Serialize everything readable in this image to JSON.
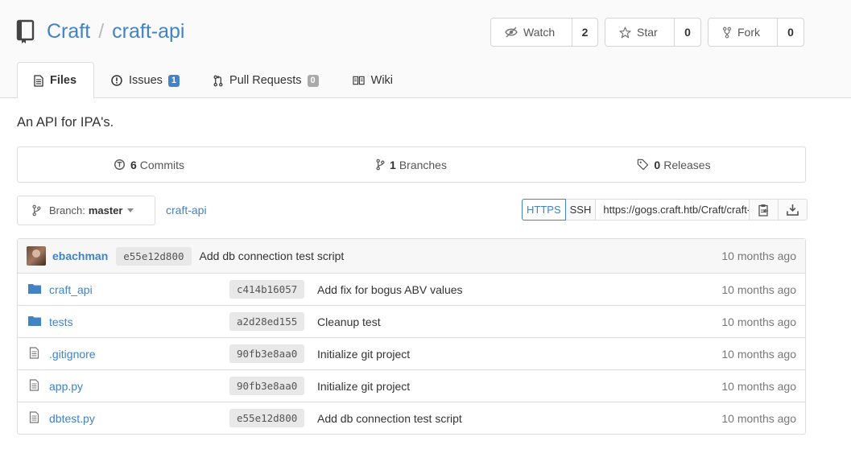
{
  "repo": {
    "owner": "Craft",
    "separator": "/",
    "name": "craft-api"
  },
  "actions": {
    "watch": {
      "label": "Watch",
      "count": "2"
    },
    "star": {
      "label": "Star",
      "count": "0"
    },
    "fork": {
      "label": "Fork",
      "count": "0"
    }
  },
  "tabs": [
    {
      "label": "Files",
      "active": true
    },
    {
      "label": "Issues",
      "badge": "1",
      "badge_color": "#4183c4"
    },
    {
      "label": "Pull Requests",
      "badge": "0",
      "badge_color": "#aaaaaa"
    },
    {
      "label": "Wiki"
    }
  ],
  "description": "An API for IPA's.",
  "stats": {
    "commits": {
      "count": "6",
      "label": "Commits"
    },
    "branches": {
      "count": "1",
      "label": "Branches"
    },
    "releases": {
      "count": "0",
      "label": "Releases"
    }
  },
  "branch": {
    "prefix": "Branch:",
    "name": "master"
  },
  "breadcrumb": "craft-api",
  "clone": {
    "https_label": "HTTPS",
    "ssh_label": "SSH",
    "url": "https://gogs.craft.htb/Craft/craft-api.git"
  },
  "latest_commit": {
    "author": "ebachman",
    "sha": "e55e12d800",
    "message": "Add db connection test script",
    "time": "10 months ago"
  },
  "files": [
    {
      "name": "craft_api",
      "type": "folder",
      "sha": "c414b16057",
      "message": "Add fix for bogus ABV values",
      "time": "10 months ago"
    },
    {
      "name": "tests",
      "type": "folder",
      "sha": "a2d28ed155",
      "message": "Cleanup test",
      "time": "10 months ago"
    },
    {
      "name": ".gitignore",
      "type": "file",
      "sha": "90fb3e8aa0",
      "message": "Initialize git project",
      "time": "10 months ago"
    },
    {
      "name": "app.py",
      "type": "file",
      "sha": "90fb3e8aa0",
      "message": "Initialize git project",
      "time": "10 months ago"
    },
    {
      "name": "dbtest.py",
      "type": "file",
      "sha": "e55e12d800",
      "message": "Add db connection test script",
      "time": "10 months ago"
    }
  ],
  "colors": {
    "link": "#4183c4",
    "folder": "#4183c4",
    "border": "#dddddd"
  }
}
